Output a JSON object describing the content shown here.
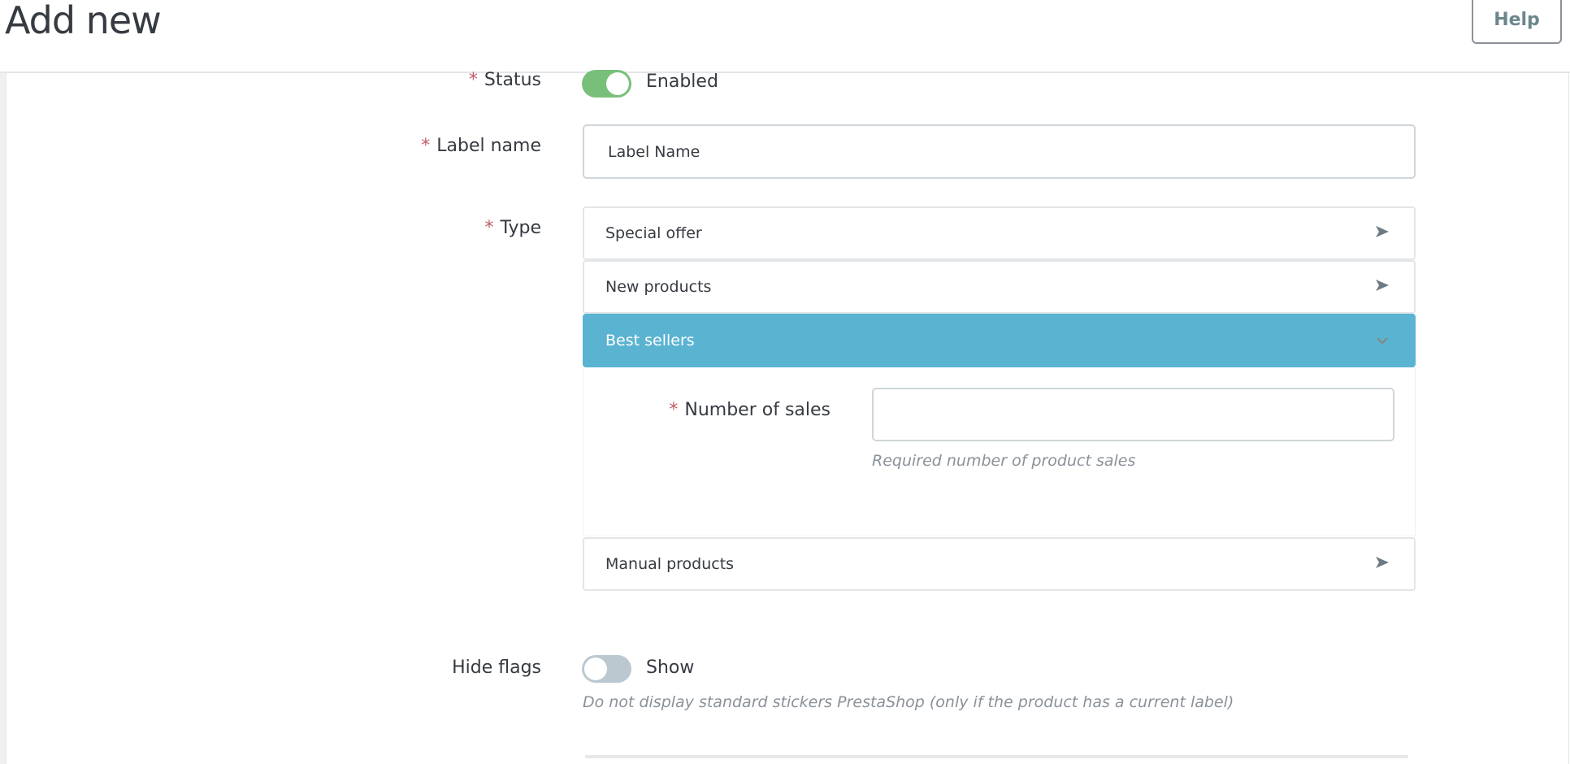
{
  "header": {
    "title": "Add new",
    "help_label": "Help"
  },
  "form": {
    "status": {
      "label": "Status",
      "required_mark": "*",
      "enabled": true,
      "value_text": "Enabled"
    },
    "label_name": {
      "label": "Label name",
      "required_mark": "*",
      "value": "Label Name",
      "placeholder": ""
    },
    "type": {
      "label": "Type",
      "required_mark": "*",
      "options": [
        {
          "label": "Special offer",
          "expanded": false,
          "icon": "arrow-right-icon"
        },
        {
          "label": "New products",
          "expanded": false,
          "icon": "arrow-right-icon"
        },
        {
          "label": "Best sellers",
          "expanded": true,
          "icon": "chevron-down-icon"
        },
        {
          "label": "Manual products",
          "expanded": false,
          "icon": "arrow-right-icon"
        }
      ],
      "best_sellers": {
        "number_of_sales": {
          "label": "Number of sales",
          "required_mark": "*",
          "value": "",
          "hint": "Required number of product sales"
        }
      }
    },
    "hide_flags": {
      "label": "Hide flags",
      "enabled": false,
      "value_text": "Show",
      "hint": "Do not display standard stickers PrestaShop (only if the product has a current label)"
    }
  },
  "colors": {
    "accent_active": "#5ab3d1",
    "toggle_on": "#78c07a",
    "toggle_off": "#bbc8cf",
    "required": "#c05c67"
  }
}
